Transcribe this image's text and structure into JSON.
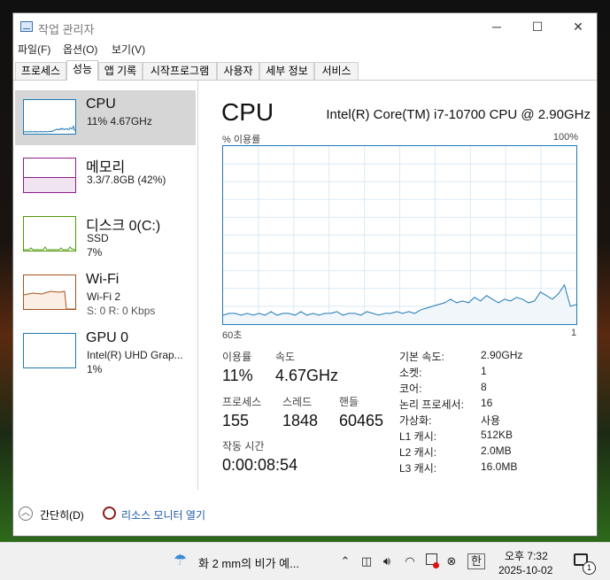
{
  "window": {
    "title": "작업 관리자",
    "controls": {
      "minimize": "─",
      "maximize": "☐",
      "close": "✕"
    }
  },
  "menu": [
    "파일(F)",
    "옵션(O)",
    "보기(V)"
  ],
  "tabs": [
    "프로세스",
    "성능",
    "앱 기록",
    "시작프로그램",
    "사용자",
    "세부 정보",
    "서비스"
  ],
  "active_tab": "성능",
  "sidebar": [
    {
      "name": "CPU",
      "line1": "11% 4.67GHz",
      "line2": "",
      "color": "#1e7ab5",
      "selected": true
    },
    {
      "name": "메모리",
      "line1": "3.3/7.8GB (42%)",
      "line2": "",
      "color": "#8a1e8a",
      "fill": 0.42
    },
    {
      "name": "디스크 0(C:)",
      "line1": "SSD",
      "line2": "7%",
      "color": "#4d9a06"
    },
    {
      "name": "Wi-Fi",
      "line1": "Wi-Fi 2",
      "line2": "S: 0 R: 0 Kbps",
      "color": "#a7521d"
    },
    {
      "name": "GPU 0",
      "line1": "Intel(R) UHD Grap...",
      "line2": "1%",
      "color": "#1e7ab5"
    }
  ],
  "main": {
    "title": "CPU",
    "model": "Intel(R) Core(TM) i7-10700 CPU @ 2.90GHz",
    "graph": {
      "ylabel": "% 이용률",
      "ymax_label": "100%",
      "xleft_label": "60초",
      "xright_label": "1"
    },
    "stats": {
      "usage_label": "이용률",
      "usage": "11%",
      "speed_label": "속도",
      "speed": "4.67GHz",
      "processes_label": "프로세스",
      "processes": "155",
      "threads_label": "스레드",
      "threads": "1848",
      "handles_label": "핸들",
      "handles": "60465",
      "uptime_label": "작동 시간",
      "uptime": "0:00:08:54"
    },
    "specs": [
      {
        "k": "기본 속도:",
        "v": "2.90GHz"
      },
      {
        "k": "소켓:",
        "v": "1"
      },
      {
        "k": "코어:",
        "v": "8"
      },
      {
        "k": "논리 프로세서:",
        "v": "16"
      },
      {
        "k": "가상화:",
        "v": "사용"
      },
      {
        "k": "L1 캐시:",
        "v": "512KB"
      },
      {
        "k": "L2 캐시:",
        "v": "2.0MB"
      },
      {
        "k": "L3 캐시:",
        "v": "16.0MB"
      }
    ]
  },
  "footer": {
    "less": "간단히(D)",
    "resmon": "리소스 모니터 열기"
  },
  "taskbar": {
    "weather": "화 2 mm의 비가 예...",
    "ime": "한",
    "time": "오후 7:32",
    "date": "2025-10-02",
    "notifications": "1"
  },
  "cpu_history_pct": [
    5,
    6,
    6,
    5,
    6,
    5,
    6,
    5,
    7,
    5,
    6,
    6,
    5,
    7,
    5,
    6,
    5,
    6,
    6,
    7,
    5,
    6,
    6,
    5,
    7,
    6,
    5,
    6,
    6,
    7,
    6,
    7,
    6,
    8,
    9,
    10,
    11,
    12,
    14,
    12,
    13,
    12,
    15,
    13,
    16,
    14,
    12,
    14,
    13,
    15,
    14,
    12,
    13,
    18,
    16,
    14,
    17,
    22,
    10,
    11
  ]
}
